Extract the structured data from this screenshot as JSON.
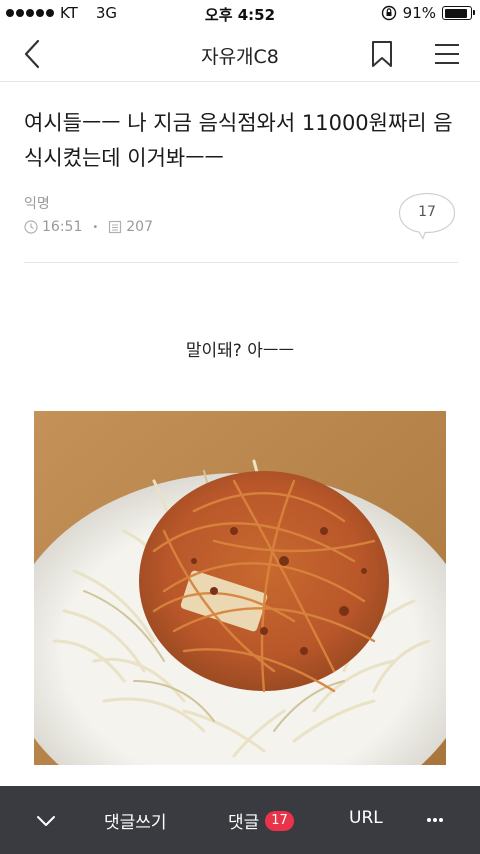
{
  "status_bar": {
    "carrier": "KT",
    "network": "3G",
    "time": "오후 4:52",
    "battery_percent": "91%",
    "battery_level": 0.91
  },
  "header": {
    "title": "자유개C8",
    "icons": {
      "back": "chevron-left-icon",
      "bookmark": "bookmark-icon",
      "menu": "hamburger-menu-icon"
    }
  },
  "post": {
    "title": "여시들ㅡㅡ 나 지금 음식점와서 11000원짜리 음식시켰는데 이거봐ㅡㅡ",
    "author": "익명",
    "time": "16:51",
    "views": "207",
    "comment_count": "17",
    "body": "말이돼? 아ㅡㅡ"
  },
  "bottom_bar": {
    "write_comment": "댓글쓰기",
    "comments_label": "댓글",
    "comments_badge": "17",
    "url_label": "URL",
    "icons": {
      "collapse": "chevron-down-icon",
      "more": "more-dots-icon"
    },
    "badge_color": "#e8334a",
    "background": "#3a3b40"
  }
}
